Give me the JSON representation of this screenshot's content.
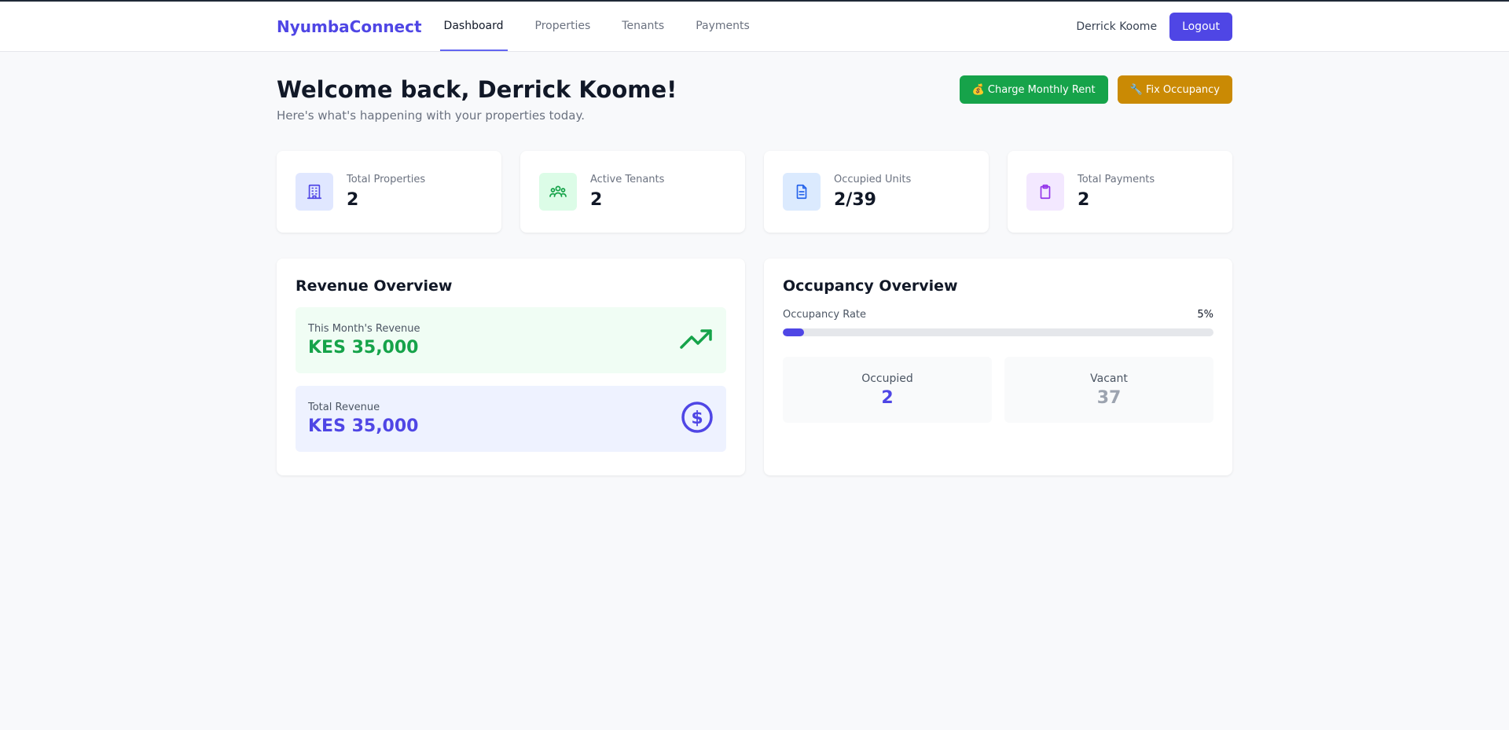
{
  "nav": {
    "brand": "NyumbaConnect",
    "links": [
      {
        "label": "Dashboard",
        "active": true
      },
      {
        "label": "Properties",
        "active": false
      },
      {
        "label": "Tenants",
        "active": false
      },
      {
        "label": "Payments",
        "active": false
      }
    ],
    "user_name": "Derrick Koome",
    "logout_label": "Logout"
  },
  "header": {
    "title": "Welcome back, Derrick Koome!",
    "subtitle": "Here's what's happening with your properties today.",
    "charge_button": "💰 Charge Monthly Rent",
    "fix_button": "🔧 Fix Occupancy"
  },
  "stats": [
    {
      "label": "Total Properties",
      "value": "2",
      "icon": "building-icon",
      "color": "#4f46e5",
      "bg": "#e0e7ff"
    },
    {
      "label": "Active Tenants",
      "value": "2",
      "icon": "users-icon",
      "color": "#16a34a",
      "bg": "#dcfce7"
    },
    {
      "label": "Occupied Units",
      "value": "2/39",
      "icon": "document-icon",
      "color": "#2563eb",
      "bg": "#dbeafe"
    },
    {
      "label": "Total Payments",
      "value": "2",
      "icon": "clipboard-icon",
      "color": "#9333ea",
      "bg": "#f3e8ff"
    }
  ],
  "revenue": {
    "title": "Revenue Overview",
    "month_label": "This Month's Revenue",
    "month_value": "KES 35,000",
    "total_label": "Total Revenue",
    "total_value": "KES 35,000"
  },
  "occupancy": {
    "title": "Occupancy Overview",
    "rate_label": "Occupancy Rate",
    "rate_text": "5%",
    "rate_fraction": 0.05,
    "occupied_label": "Occupied",
    "occupied_value": "2",
    "vacant_label": "Vacant",
    "vacant_value": "37"
  }
}
